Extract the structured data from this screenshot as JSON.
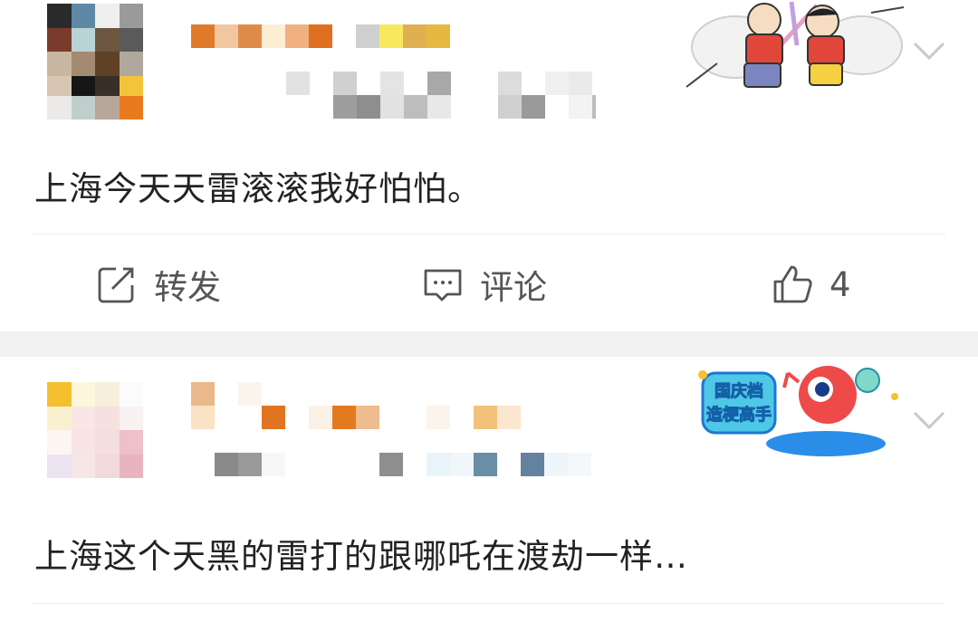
{
  "posts": [
    {
      "text": "上海今天天雷滚滚我好怕怕。",
      "badge_icon": "cartoon-fight-sticker-icon",
      "actions": {
        "repost_label": "转发",
        "comment_label": "评论",
        "like_count": "4"
      }
    },
    {
      "text": "上海这个天黑的雷打的跟哪吒在渡劫一样…",
      "badge_icon": "national-day-badge-icon",
      "badge_text": [
        "国庆档",
        "造梗高手"
      ]
    }
  ],
  "colors": {
    "separator": "#f2f2f2",
    "divider": "#ececec",
    "text": "#222222",
    "action_text": "#555555"
  }
}
